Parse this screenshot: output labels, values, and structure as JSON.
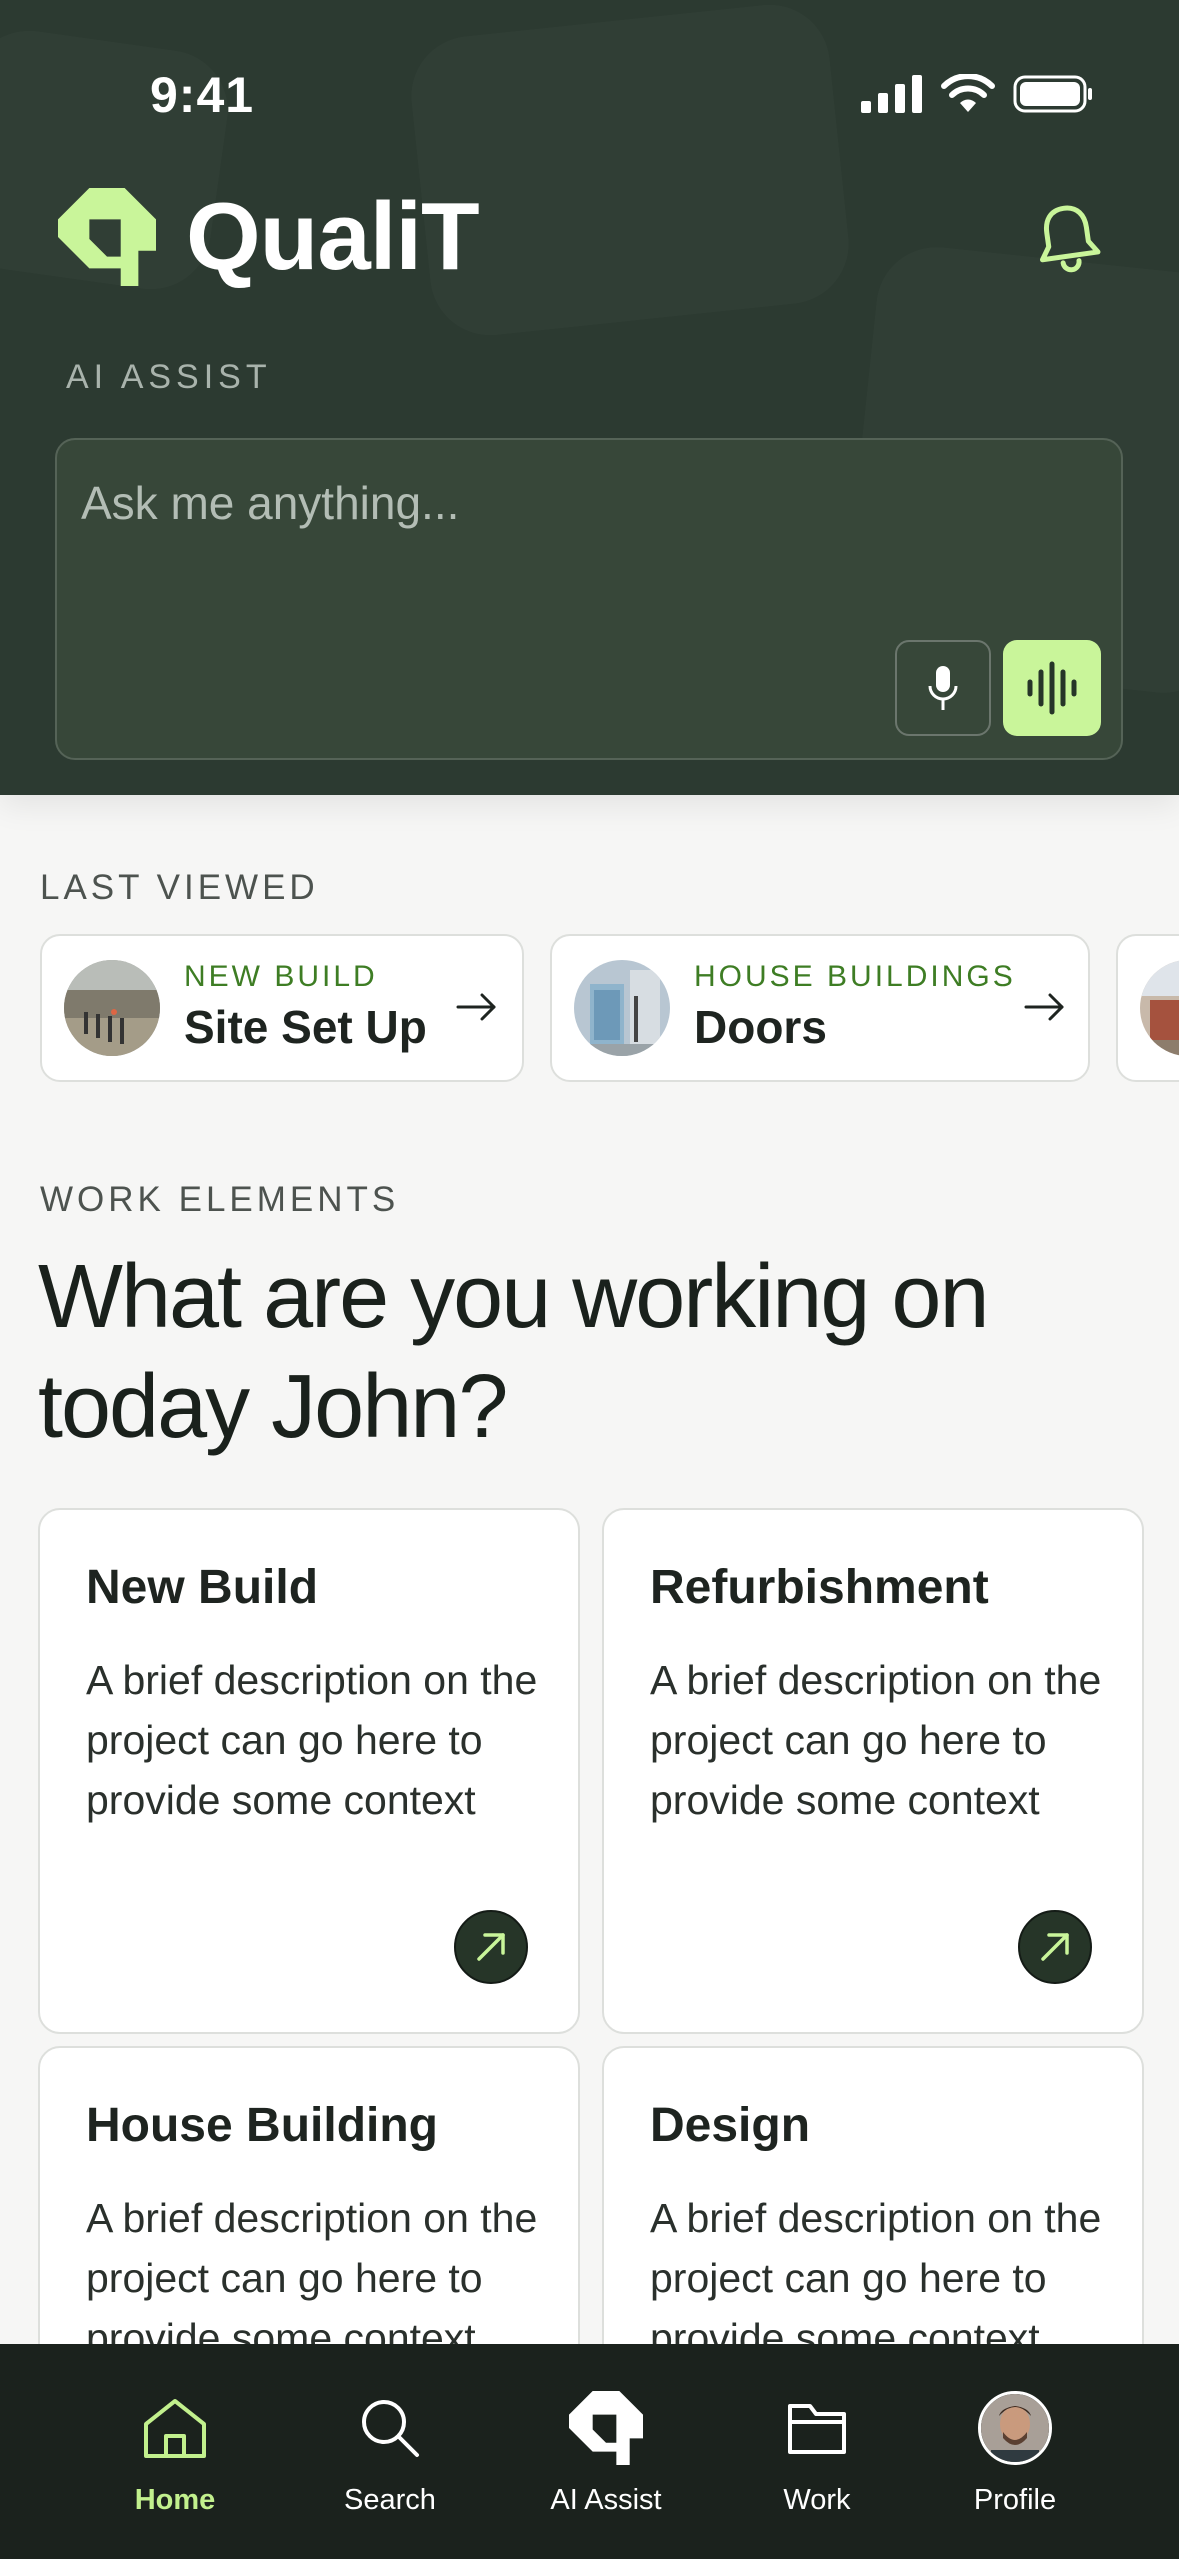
{
  "status_bar": {
    "time": "9:41"
  },
  "header": {
    "app_name": "QualiT",
    "ai_label": "AI ASSIST",
    "ai_placeholder": "Ask me anything..."
  },
  "last_viewed": {
    "label": "LAST VIEWED",
    "items": [
      {
        "category": "NEW BUILD",
        "title": "Site Set Up"
      },
      {
        "category": "HOUSE BUILDINGS",
        "title": "Doors"
      }
    ]
  },
  "work_elements": {
    "label": "WORK ELEMENTS",
    "heading": "What are you working on today John?",
    "cards": [
      {
        "title": "New Build",
        "description": "A brief description on the project can go here to provide some context"
      },
      {
        "title": "Refurbishment",
        "description": "A brief description on the project can go here to provide some context"
      },
      {
        "title": "House Building",
        "description": "A brief description on the project can go here to provide some context"
      },
      {
        "title": "Design",
        "description": "A brief description on the project can go here to provide some context"
      }
    ]
  },
  "tabbar": {
    "active": "Home",
    "tabs": [
      {
        "label": "Home",
        "icon": "home-icon"
      },
      {
        "label": "Search",
        "icon": "search-icon"
      },
      {
        "label": "AI Assist",
        "icon": "qualit-logo-icon"
      },
      {
        "label": "Work",
        "icon": "folder-icon"
      },
      {
        "label": "Profile",
        "icon": "avatar"
      }
    ]
  },
  "colors": {
    "header_bg": "#2c3a31",
    "accent_green": "#c9f59a",
    "category_green": "#3e7d24",
    "tabbar_bg": "#1b221d"
  }
}
